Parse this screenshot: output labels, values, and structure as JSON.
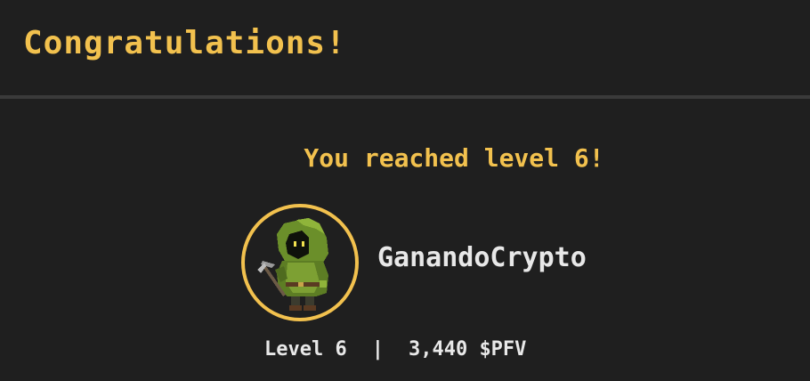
{
  "header": {
    "title": "Congratulations!"
  },
  "main": {
    "message": "You reached level 6!",
    "player": {
      "avatar_icon": "hooded-goblin-miner-icon",
      "username": "GanandoCrypto"
    },
    "stats": {
      "level": "Level 6",
      "separator": "|",
      "balance": "3,440 $PFV"
    }
  },
  "colors": {
    "background": "#1f1f1f",
    "accent": "#f2c14e",
    "text": "#e8e8e8",
    "divider": "#3a3a3a"
  }
}
